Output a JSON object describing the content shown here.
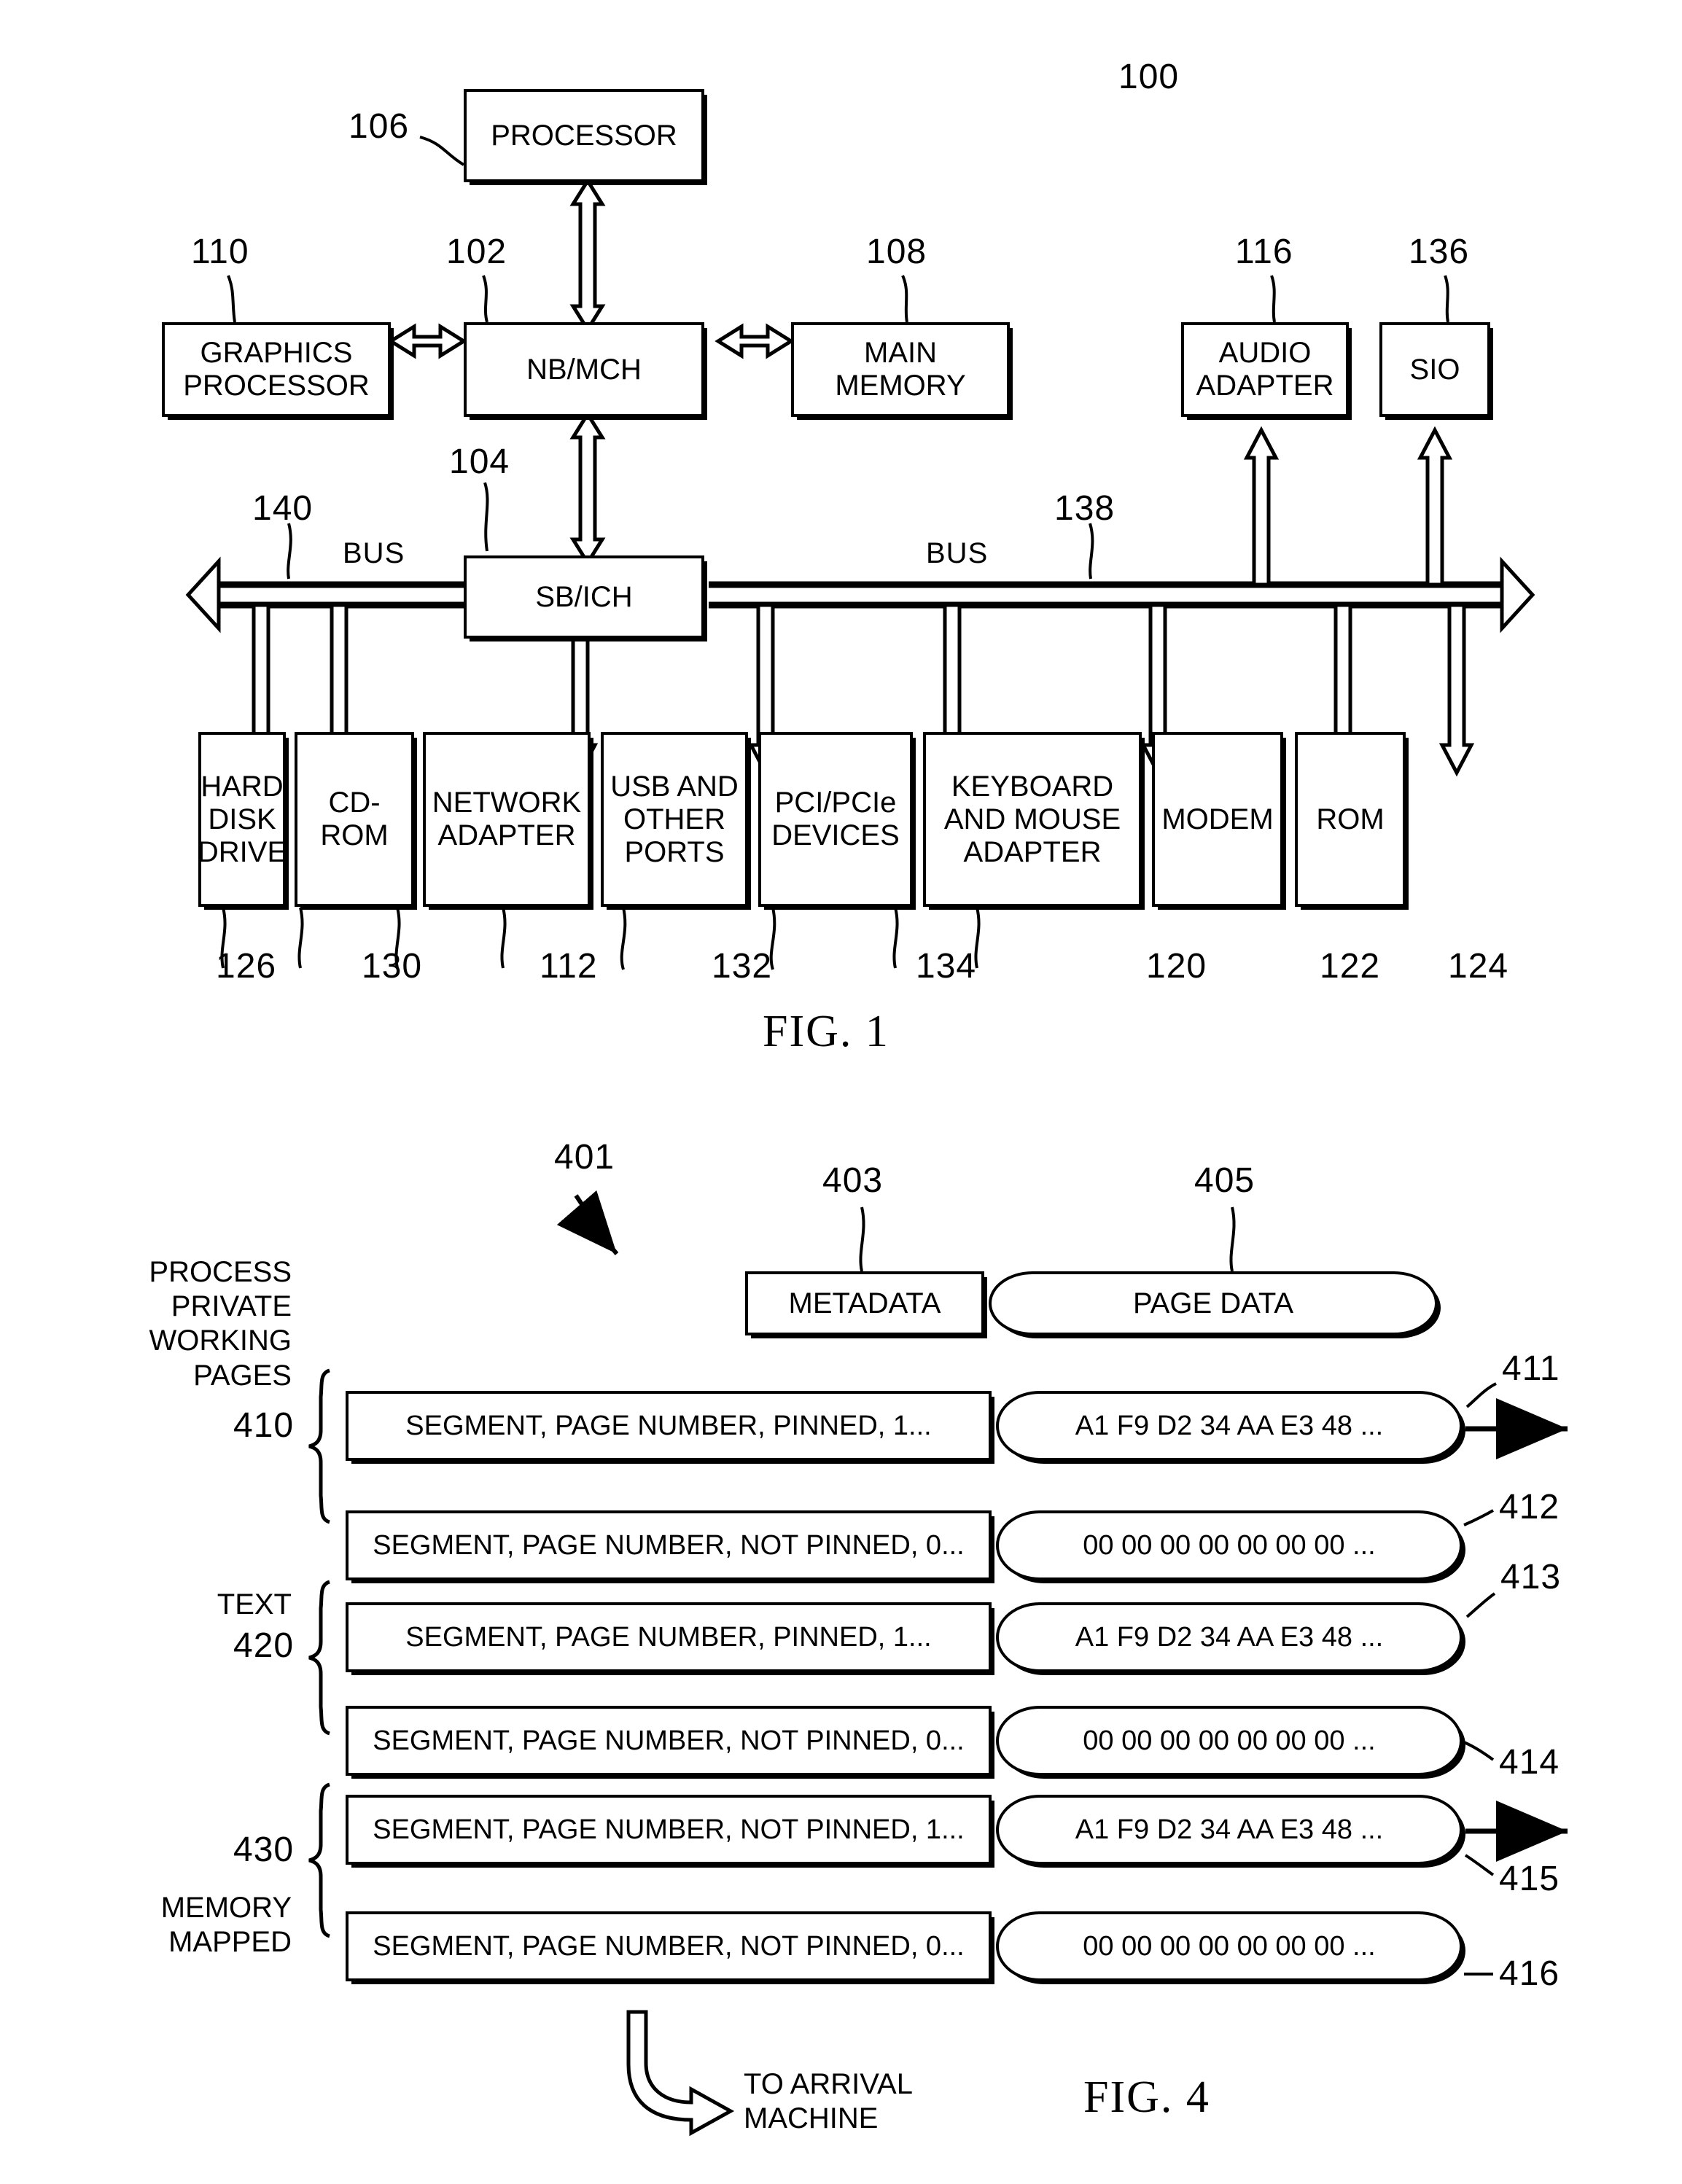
{
  "figure1": {
    "caption": "FIG. 1",
    "system_ref": "100",
    "boxes": {
      "processor": {
        "label": "PROCESSOR",
        "ref": "106"
      },
      "graphics": {
        "label": "GRAPHICS\nPROCESSOR",
        "ref": "110"
      },
      "nbmch": {
        "label": "NB/MCH",
        "ref": "102"
      },
      "main_memory": {
        "label": "MAIN\nMEMORY",
        "ref": "108"
      },
      "audio_adapter": {
        "label": "AUDIO\nADAPTER",
        "ref": "116"
      },
      "sio": {
        "label": "SIO",
        "ref": "136"
      },
      "sbich": {
        "label": "SB/ICH",
        "ref": "104"
      },
      "hdd": {
        "label": "HARD\nDISK\nDRIVE",
        "ref": "126"
      },
      "cdrom": {
        "label": "CD-ROM",
        "ref": "130"
      },
      "network_adapter": {
        "label": "NETWORK\nADAPTER",
        "ref": "112"
      },
      "usb_ports": {
        "label": "USB AND\nOTHER\nPORTS",
        "ref": "132"
      },
      "pci_devices": {
        "label": "PCI/PCIe\nDEVICES",
        "ref": "134"
      },
      "keyboard_mouse": {
        "label": "KEYBOARD\nAND MOUSE\nADAPTER",
        "ref": "120"
      },
      "modem": {
        "label": "MODEM",
        "ref": "122"
      },
      "rom": {
        "label": "ROM",
        "ref": "124"
      }
    },
    "bus_left": {
      "label": "BUS",
      "ref": "140"
    },
    "bus_right": {
      "label": "BUS",
      "ref": "138"
    }
  },
  "figure4": {
    "caption": "FIG. 4",
    "system_ref": "401",
    "headers": {
      "metadata": {
        "label": "METADATA",
        "ref": "403"
      },
      "pagedata": {
        "label": "PAGE DATA",
        "ref": "405"
      }
    },
    "groups": [
      {
        "label": "PROCESS\nPRIVATE\nWORKING\nPAGES",
        "ref": "410"
      },
      {
        "label": "TEXT",
        "ref": "420"
      },
      {
        "label": "MEMORY\nMAPPED",
        "ref": "430"
      }
    ],
    "rows": [
      {
        "metadata": "SEGMENT, PAGE NUMBER, PINNED, 1...",
        "pagedata": "A1 F9 D2 34 AA E3 48 ...",
        "ref": "411",
        "has_out_arrow": true
      },
      {
        "metadata": "SEGMENT, PAGE NUMBER, NOT PINNED, 0...",
        "pagedata": "00 00 00 00 00 00 00 ...",
        "ref": "412",
        "has_out_arrow": false
      },
      {
        "metadata": "SEGMENT, PAGE NUMBER, PINNED, 1...",
        "pagedata": "A1 F9 D2 34 AA E3 48 ...",
        "ref": "413",
        "has_out_arrow": false
      },
      {
        "metadata": "SEGMENT, PAGE NUMBER, NOT PINNED, 0...",
        "pagedata": "00 00 00 00 00 00 00 ...",
        "ref": "414",
        "has_out_arrow": false
      },
      {
        "metadata": "SEGMENT, PAGE NUMBER, NOT PINNED, 1...",
        "pagedata": "A1 F9 D2 34 AA E3 48 ...",
        "ref": "415",
        "has_out_arrow": true
      },
      {
        "metadata": "SEGMENT, PAGE NUMBER, NOT PINNED, 0...",
        "pagedata": "00 00 00 00 00 00 00 ...",
        "ref": "416",
        "has_out_arrow": false
      }
    ],
    "bottom_arrow_label": "TO ARRIVAL\nMACHINE"
  },
  "colors": {
    "ink": "#000000",
    "paper": "#ffffff"
  }
}
